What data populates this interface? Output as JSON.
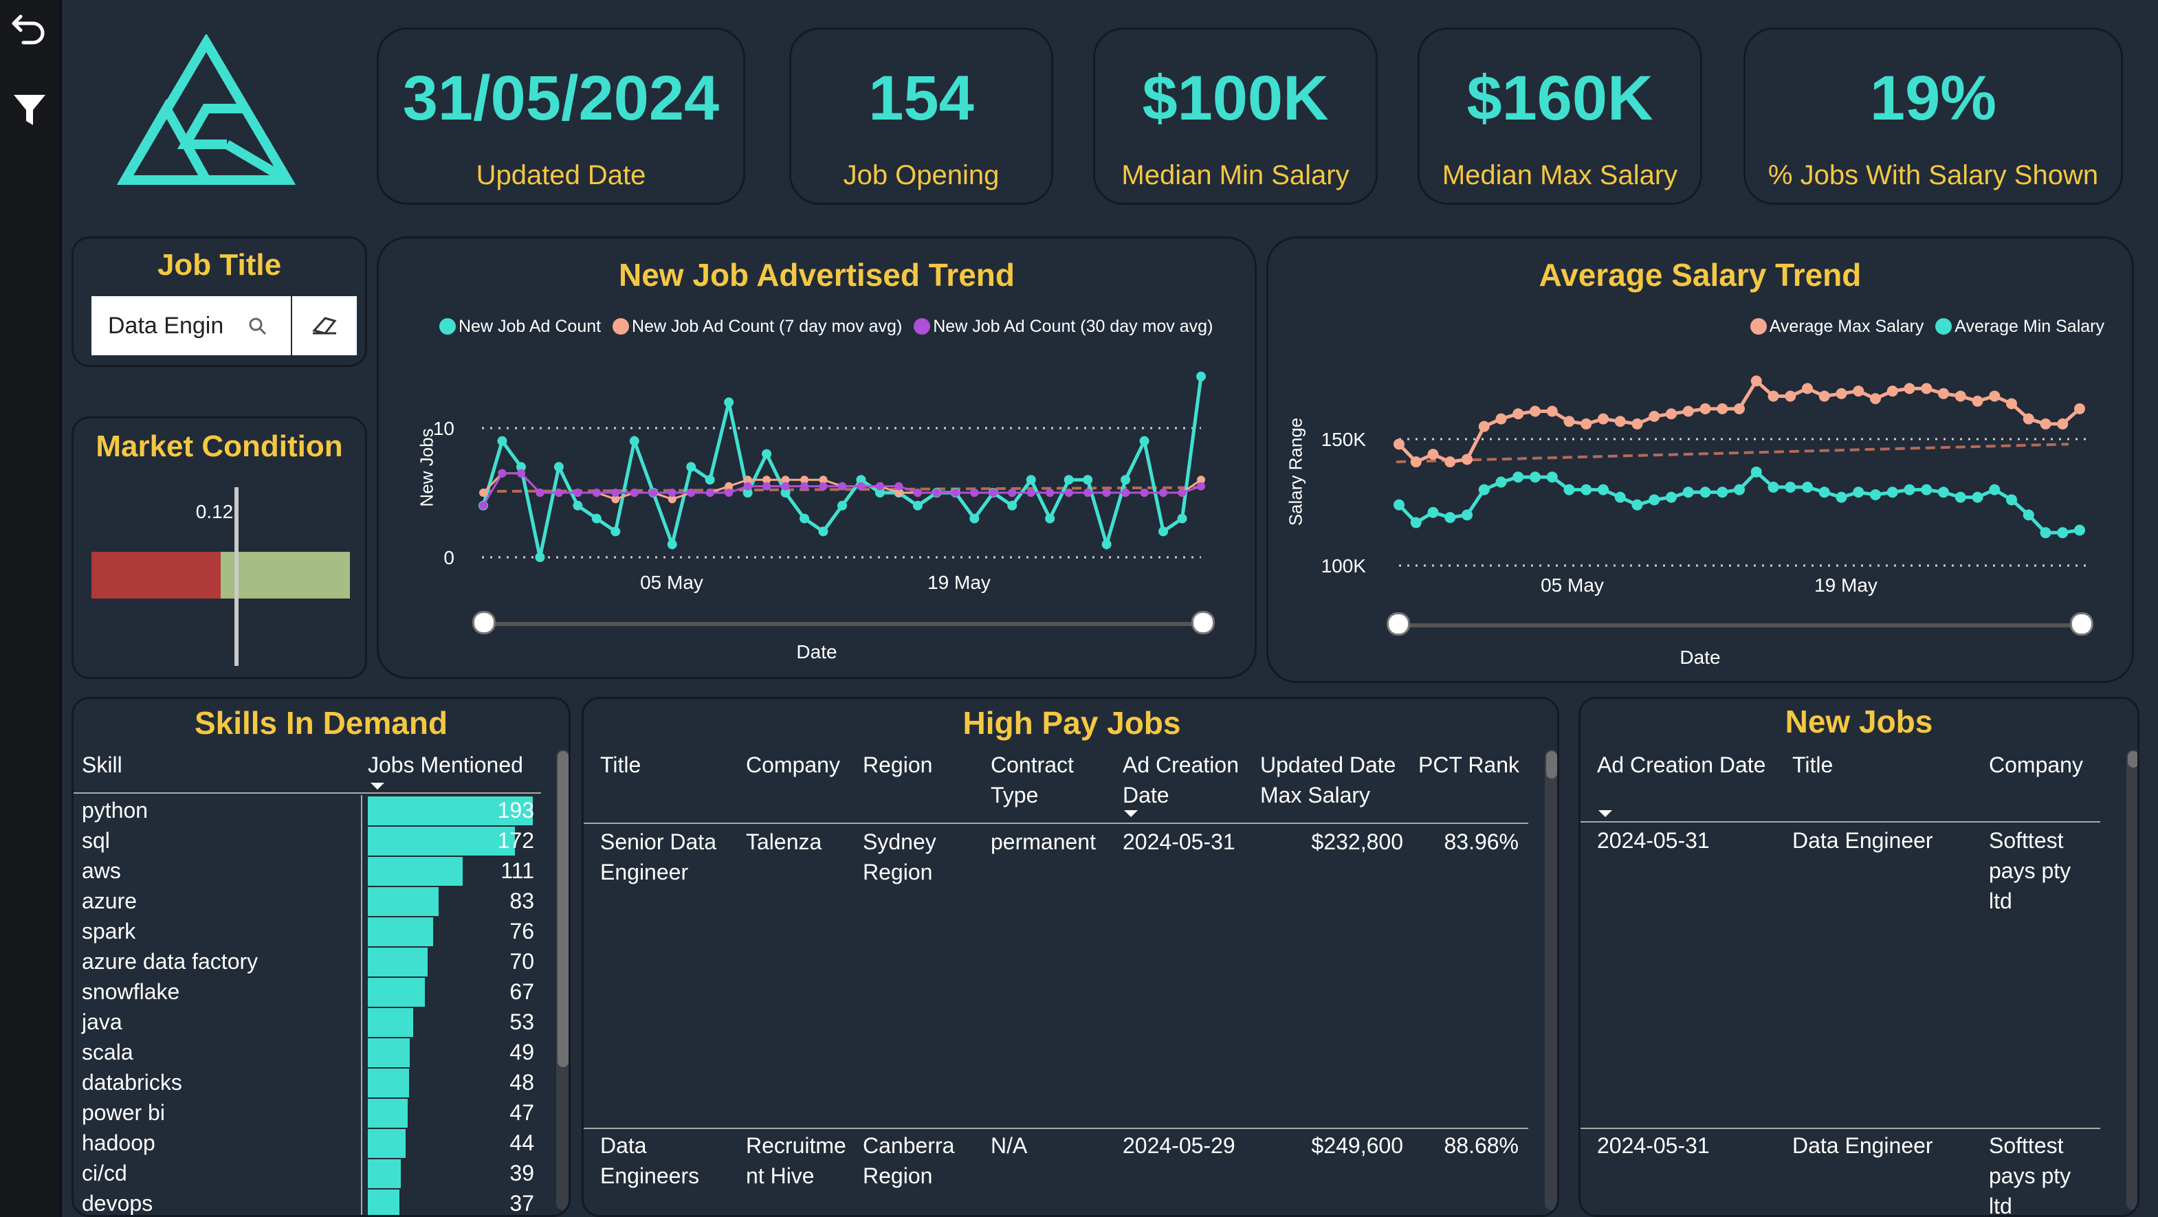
{
  "colors": {
    "accent": "#40e0d0",
    "title": "#f5c842",
    "salmon": "#f5a88e",
    "purple": "#b04fd8",
    "bg": "#222b38"
  },
  "toolbar": {
    "back_icon": "undo-arrow-icon",
    "filter_icon": "funnel-filter-icon"
  },
  "kpis": [
    {
      "value": "31/05/2024",
      "label": "Updated Date"
    },
    {
      "value": "154",
      "label": "Job Opening"
    },
    {
      "value": "$100K",
      "label": "Median Min Salary"
    },
    {
      "value": "$160K",
      "label": "Median Max Salary"
    },
    {
      "value": "19%",
      "label": "% Jobs With Salary Shown"
    }
  ],
  "job_title": {
    "title": "Job Title",
    "value": "Data Engin",
    "search_icon": "search-icon",
    "eraser_icon": "eraser-icon"
  },
  "market": {
    "title": "Market Condition",
    "value_label": "0.12",
    "value": 0.12,
    "bad_share": 0.5
  },
  "trend": {
    "title": "New Job Advertised Trend",
    "legend": [
      "New Job Ad Count",
      "New Job Ad Count (7 day mov avg)",
      "New Job Ad Count (30 day mov avg)"
    ],
    "ylabel": "New Jobs",
    "xlabel": "Date",
    "yticks": [
      "10",
      "0"
    ],
    "xticks": [
      "05 May",
      "19 May"
    ]
  },
  "salary": {
    "title": "Average Salary Trend",
    "legend": [
      "Average Max Salary",
      "Average Min Salary"
    ],
    "ylabel": "Salary Range",
    "xlabel": "Date",
    "yticks": [
      "150K",
      "100K"
    ],
    "xticks": [
      "05 May",
      "19 May"
    ]
  },
  "chart_data": [
    {
      "type": "line",
      "title": "New Job Advertised Trend",
      "xlabel": "Date",
      "ylabel": "New Jobs",
      "ylim": [
        0,
        14
      ],
      "x_range": [
        "2024-04-28",
        "2024-05-31"
      ],
      "series": [
        {
          "name": "New Job Ad Count",
          "values": [
            4,
            9,
            7,
            0,
            7,
            4,
            3,
            2,
            9,
            5,
            1,
            7,
            6,
            12,
            5,
            8,
            5,
            3,
            2,
            4,
            6,
            5,
            5,
            4,
            5,
            5,
            3,
            5,
            4,
            6,
            3,
            6,
            6,
            1,
            6,
            9,
            2,
            3,
            14
          ]
        },
        {
          "name": "New Job Ad Count (7 day mov avg)",
          "values": [
            5,
            6.5,
            6.5,
            5,
            5,
            5,
            5,
            4.5,
            5,
            5,
            4.5,
            5,
            5,
            5.5,
            6,
            6,
            6,
            6,
            6,
            5.5,
            5.5,
            5.5,
            5,
            5,
            5,
            5,
            5,
            5,
            5,
            5,
            5,
            5,
            5,
            5,
            5,
            5,
            5,
            5,
            6
          ]
        },
        {
          "name": "New Job Ad Count (30 day mov avg)",
          "values": [
            4,
            6.5,
            6.5,
            5,
            5,
            5,
            5,
            5,
            5,
            5,
            5,
            5,
            5,
            5,
            5.5,
            5.5,
            5.5,
            5.5,
            5.5,
            5.5,
            5.5,
            5.5,
            5.5,
            5,
            5,
            5,
            5,
            5,
            5,
            5,
            5,
            5,
            5,
            5,
            5,
            5,
            5,
            5,
            5.5
          ]
        }
      ]
    },
    {
      "type": "line",
      "title": "Average Salary Trend",
      "xlabel": "Date",
      "ylabel": "Salary Range",
      "ylim": [
        90000,
        185000
      ],
      "series": [
        {
          "name": "Average Max Salary",
          "values": [
            148000,
            141000,
            144000,
            141000,
            142000,
            155000,
            158000,
            160000,
            161000,
            161000,
            157000,
            156000,
            158000,
            157000,
            156000,
            159000,
            160000,
            161000,
            162000,
            162000,
            162000,
            173000,
            167000,
            167000,
            170000,
            167000,
            168000,
            169000,
            166000,
            169000,
            170000,
            170000,
            168000,
            167000,
            165000,
            167000,
            164000,
            158000,
            156000,
            156000,
            162000
          ]
        },
        {
          "name": "Average Min Salary",
          "values": [
            124000,
            117000,
            121000,
            119000,
            120000,
            130000,
            133000,
            135000,
            135000,
            135000,
            130000,
            130000,
            130000,
            127000,
            124000,
            126000,
            127000,
            129000,
            129000,
            129000,
            130000,
            137000,
            131000,
            131000,
            131000,
            129000,
            127000,
            129000,
            128000,
            129000,
            130000,
            130000,
            129000,
            127000,
            127000,
            130000,
            126000,
            120000,
            113000,
            113000,
            114000
          ]
        }
      ]
    }
  ],
  "skills": {
    "title": "Skills In Demand",
    "col_skill": "Skill",
    "col_jobs": "Jobs Mentioned",
    "rows": [
      {
        "skill": "python",
        "count": "193"
      },
      {
        "skill": "sql",
        "count": "172"
      },
      {
        "skill": "aws",
        "count": "111"
      },
      {
        "skill": "azure",
        "count": "83"
      },
      {
        "skill": "spark",
        "count": "76"
      },
      {
        "skill": "azure data factory",
        "count": "70"
      },
      {
        "skill": "snowflake",
        "count": "67"
      },
      {
        "skill": "java",
        "count": "53"
      },
      {
        "skill": "scala",
        "count": "49"
      },
      {
        "skill": "databricks",
        "count": "48"
      },
      {
        "skill": "power bi",
        "count": "47"
      },
      {
        "skill": "hadoop",
        "count": "44"
      },
      {
        "skill": "ci/cd",
        "count": "39"
      },
      {
        "skill": "devops",
        "count": "37"
      }
    ]
  },
  "high_pay": {
    "title": "High Pay Jobs",
    "headers": {
      "title": "Title",
      "company": "Company",
      "region": "Region",
      "contract": "Contract Type",
      "ad_date": "Ad Creation Date",
      "max_salary": "Updated Date Max Salary",
      "pct": "PCT Rank"
    },
    "rows": [
      {
        "title": "Senior Data Engineer",
        "company": "Talenza",
        "region": "Sydney Region",
        "contract": "permanent",
        "ad_date": "2024-05-31",
        "max_salary": "$232,800",
        "pct": "83.96%"
      },
      {
        "title": "Data Engineers",
        "company": "Recruitme nt Hive",
        "region": "Canberra Region",
        "contract": "N/A",
        "ad_date": "2024-05-29",
        "max_salary": "$249,600",
        "pct": "88.68%"
      }
    ]
  },
  "new_jobs": {
    "title": "New Jobs",
    "headers": {
      "ad_date": "Ad Creation Date",
      "title": "Title",
      "company": "Company"
    },
    "rows": [
      {
        "ad_date": "2024-05-31",
        "title": "Data Engineer",
        "company": "Softtest pays pty ltd"
      },
      {
        "ad_date": "2024-05-31",
        "title": "Data Engineer",
        "company": "Softtest pays pty ltd"
      }
    ]
  }
}
